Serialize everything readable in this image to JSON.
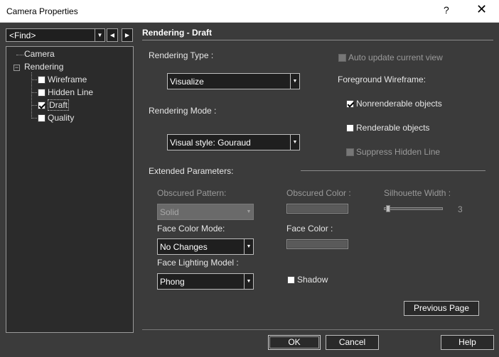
{
  "window": {
    "title": "Camera Properties",
    "help_glyph": "?",
    "close_glyph": "✕"
  },
  "find": {
    "value": "<Find>"
  },
  "tree": {
    "camera": "Camera",
    "rendering": "Rendering",
    "children": [
      {
        "label": "Wireframe",
        "checked": false
      },
      {
        "label": "Hidden Line",
        "checked": false
      },
      {
        "label": "Draft",
        "checked": true
      },
      {
        "label": "Quality",
        "checked": false
      }
    ]
  },
  "page": {
    "header": "Rendering - Draft",
    "rendering_type_label": "Rendering Type :",
    "rendering_type_value": "Visualize",
    "rendering_mode_label": "Rendering Mode :",
    "rendering_mode_value": "Visual style: Gouraud",
    "auto_update_label": "Auto update current view",
    "foreground_wireframe_label": "Foreground Wireframe:",
    "nonrenderable_label": "Nonrenderable objects",
    "renderable_label": "Renderable objects",
    "suppress_label": "Suppress Hidden Line",
    "extended_label": "Extended Parameters:",
    "obscured_pattern_label": "Obscured Pattern:",
    "obscured_pattern_value": "Solid",
    "obscured_color_label": "Obscured Color :",
    "silhouette_label": "Silhouette Width :",
    "silhouette_value": "3",
    "face_color_mode_label": "Face Color Mode:",
    "face_color_mode_value": "No Changes",
    "face_color_label": "Face Color :",
    "face_lighting_label": "Face Lighting Model :",
    "face_lighting_value": "Phong",
    "shadow_label": "Shadow",
    "previous_page": "Previous Page"
  },
  "buttons": {
    "ok": "OK",
    "cancel": "Cancel",
    "help": "Help"
  }
}
